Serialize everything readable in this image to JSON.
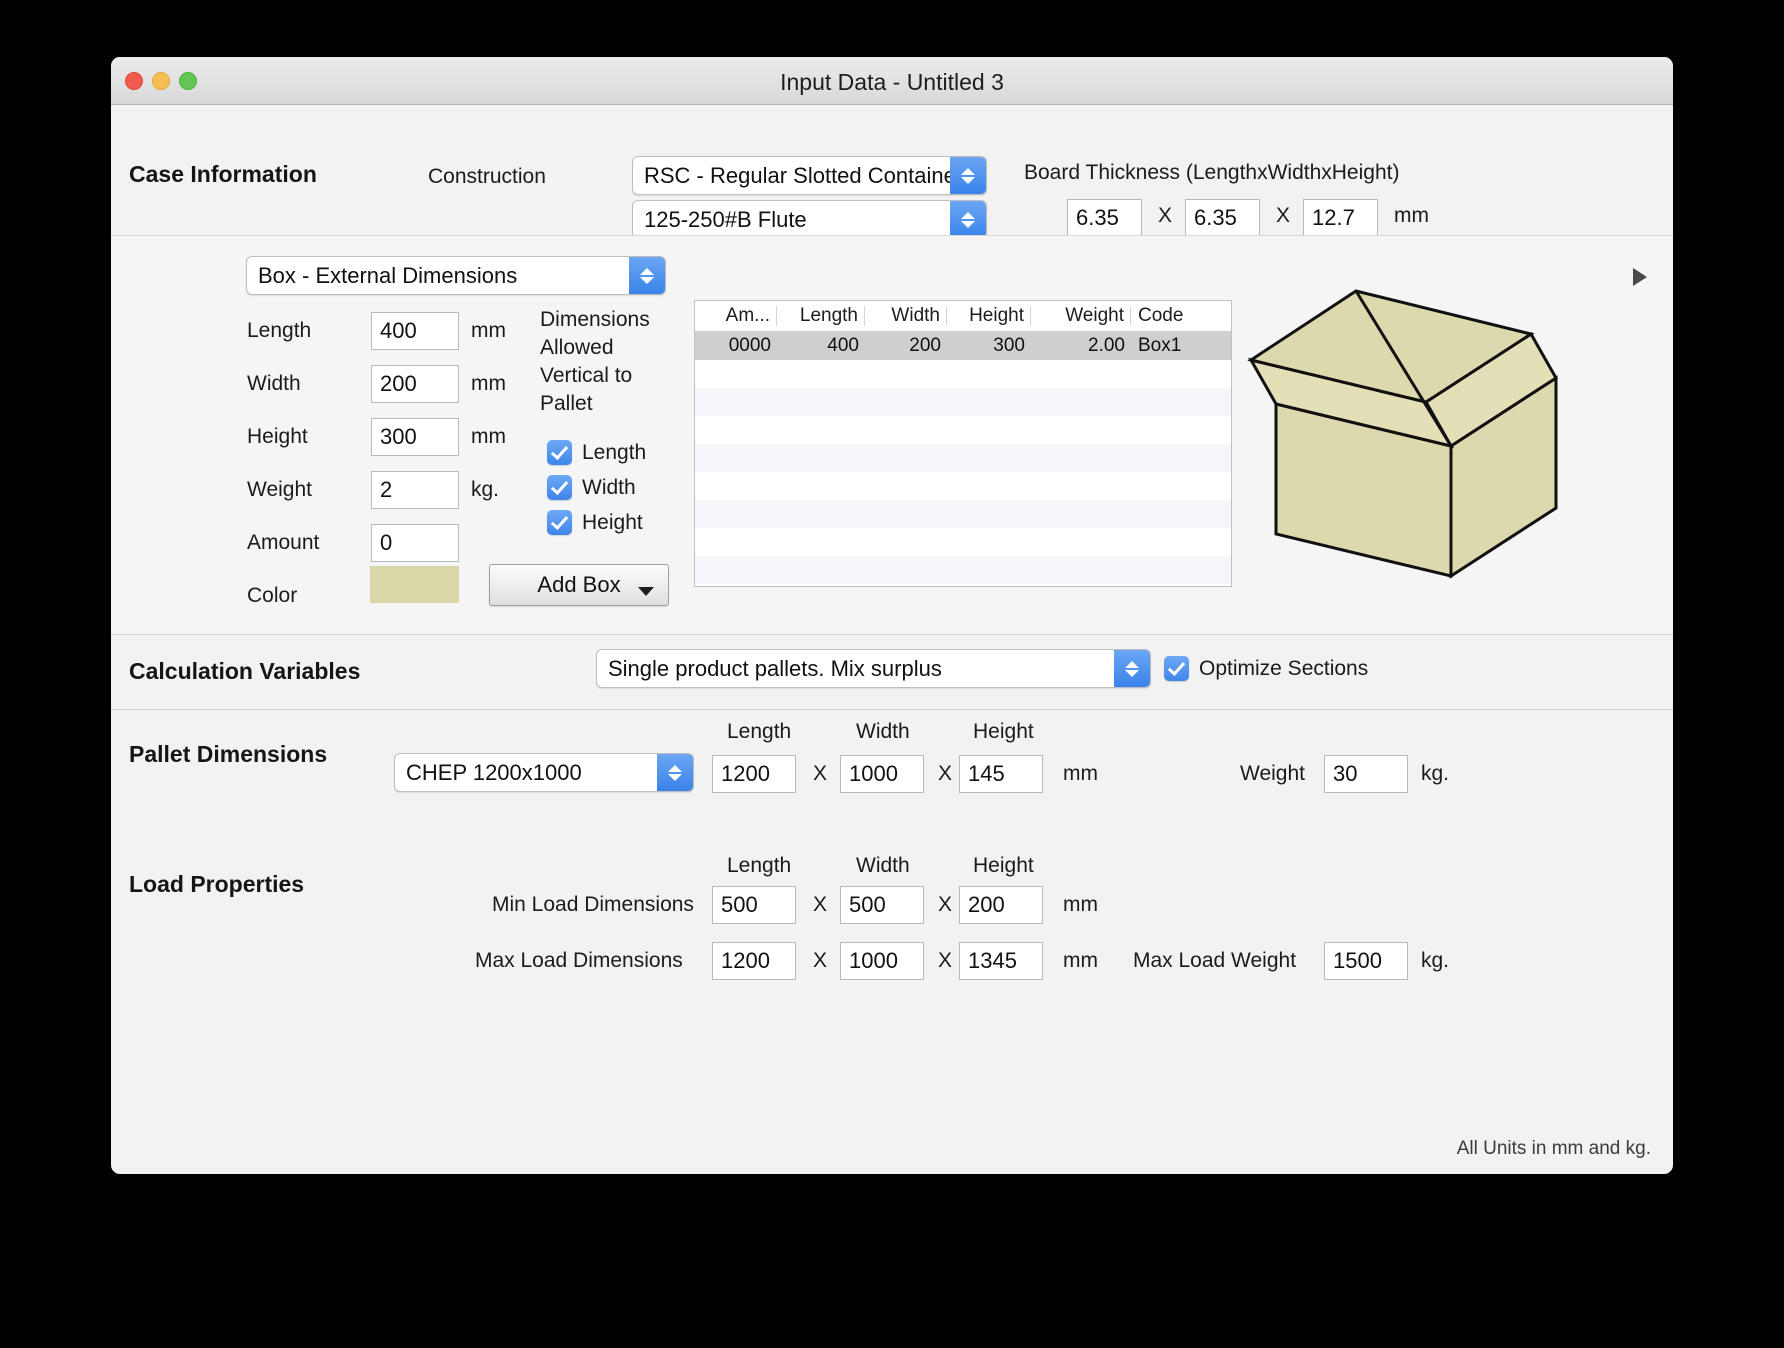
{
  "window": {
    "title": "Input Data - Untitled 3"
  },
  "case_information": {
    "heading": "Case Information",
    "construction_label": "Construction",
    "construction_value": "RSC - Regular Slotted Container",
    "flute_value": "125-250#B Flute",
    "board_thickness_label": "Board Thickness (LengthxWidthxHeight)",
    "thickness_length": "6.35",
    "thickness_width": "6.35",
    "thickness_height": "12.7",
    "separator": "X",
    "unit": "mm"
  },
  "box_section": {
    "mode_value": "Box - External Dimensions",
    "length_label": "Length",
    "length_value": "400",
    "width_label": "Width",
    "width_value": "200",
    "height_label": "Height",
    "height_value": "300",
    "weight_label": "Weight",
    "weight_value": "2",
    "amount_label": "Amount",
    "amount_value": "0",
    "color_label": "Color",
    "color_swatch": "#d9d6a8",
    "unit_mm": "mm",
    "unit_kg": "kg.",
    "allowed_title": "Dimensions Allowed Vertical to Pallet",
    "allowed": [
      {
        "label": "Length",
        "checked": true
      },
      {
        "label": "Width",
        "checked": true
      },
      {
        "label": "Height",
        "checked": true
      }
    ],
    "add_box_label": "Add Box",
    "table": {
      "columns": [
        "Am...",
        "Length",
        "Width",
        "Height",
        "Weight",
        "Code"
      ],
      "rows": [
        [
          "0000",
          "400",
          "200",
          "300",
          "2.00",
          "Box1"
        ]
      ]
    }
  },
  "calculation_variables": {
    "heading": "Calculation Variables",
    "mode_value": "Single product pallets. Mix surplus",
    "optimize_label": "Optimize Sections",
    "optimize_checked": true
  },
  "pallet_dimensions": {
    "heading": "Pallet Dimensions",
    "pallet_value": "CHEP 1200x1000",
    "col_length": "Length",
    "col_width": "Width",
    "col_height": "Height",
    "length_value": "1200",
    "width_value": "1000",
    "height_value": "145",
    "separator": "X",
    "unit": "mm",
    "weight_label": "Weight",
    "weight_value": "30",
    "weight_unit": "kg."
  },
  "load_properties": {
    "heading": "Load Properties",
    "col_length": "Length",
    "col_width": "Width",
    "col_height": "Height",
    "min_label": "Min Load Dimensions",
    "min_length": "500",
    "min_width": "500",
    "min_height": "200",
    "max_label": "Max Load Dimensions",
    "max_length": "1200",
    "max_width": "1000",
    "max_height": "1345",
    "separator": "X",
    "unit": "mm",
    "max_weight_label": "Max Load Weight",
    "max_weight_value": "1500",
    "max_weight_unit": "kg."
  },
  "footer": {
    "note": "All Units in mm and kg."
  }
}
